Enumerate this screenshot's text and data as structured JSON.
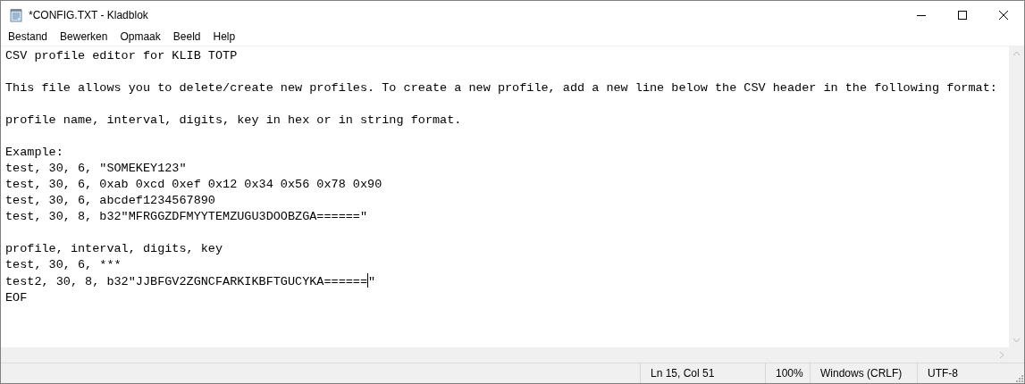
{
  "window": {
    "title": "*CONFIG.TXT - Kladblok"
  },
  "menu": [
    "Bestand",
    "Bewerken",
    "Opmaak",
    "Beeld",
    "Help"
  ],
  "editor": {
    "blocks": [
      [
        "CSV profile editor for KLIB TOTP"
      ],
      [
        "This file allows you to delete/create new profiles. To create a new profile, add a new line below the CSV header in the following format:"
      ],
      [
        "profile name, interval, digits, key in hex or in string format."
      ],
      [
        "Example:",
        "test, 30, 6, \"SOMEKEY123\"",
        "test, 30, 6, 0xab 0xcd 0xef 0x12 0x34 0x56 0x78 0x90",
        "test, 30, 6, abcdef1234567890",
        "test, 30, 8, b32\"MFRGGZDFMYYTEMZUGU3DOOBZGA======\""
      ],
      [
        "profile, interval, digits, key",
        "test, 30, 6, ***",
        {
          "text": "test2, 30, 8, b32\"JJBFGV2ZGNCFARKIKBFTGUCYKA======",
          "after_caret": "\""
        },
        "EOF"
      ]
    ]
  },
  "status_bar": [
    "Ln 15, Col 51",
    "100%",
    "Windows (CRLF)",
    "UTF-8"
  ]
}
